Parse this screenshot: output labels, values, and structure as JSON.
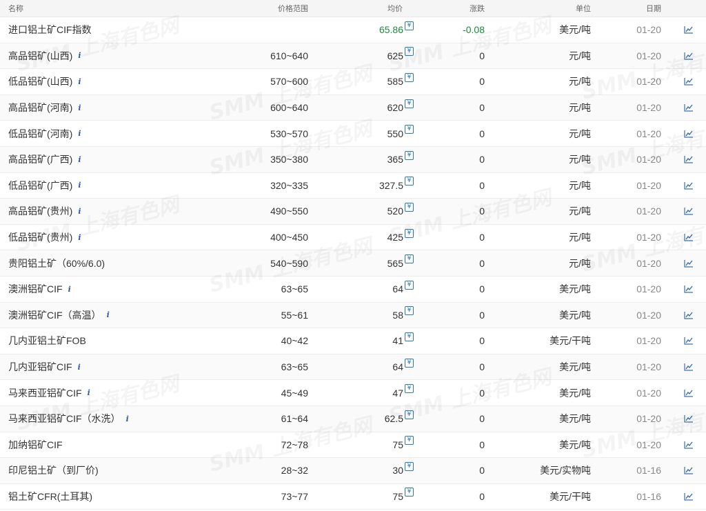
{
  "header": {
    "name": "名称",
    "range": "价格范围",
    "avg": "均价",
    "change": "涨跌",
    "unit": "单位",
    "date": "日期"
  },
  "watermark_text": "SMM 上海有色网",
  "colors": {
    "positive_green": "#1a8a3a",
    "link_blue": "#2a7ab8",
    "header_bg": "#f5f5f5"
  },
  "rows": [
    {
      "name": "进口铝土矿CIF指数",
      "info": false,
      "range": "",
      "avg": "65.86",
      "change": "-0.08",
      "unit": "美元/吨",
      "date": "01-20",
      "highlight": true
    },
    {
      "name": "高品铝矿(山西)",
      "info": true,
      "range": "610~640",
      "avg": "625",
      "change": "0",
      "unit": "元/吨",
      "date": "01-20"
    },
    {
      "name": "低品铝矿(山西)",
      "info": true,
      "range": "570~600",
      "avg": "585",
      "change": "0",
      "unit": "元/吨",
      "date": "01-20"
    },
    {
      "name": "高品铝矿(河南)",
      "info": true,
      "range": "600~640",
      "avg": "620",
      "change": "0",
      "unit": "元/吨",
      "date": "01-20"
    },
    {
      "name": "低品铝矿(河南)",
      "info": true,
      "range": "530~570",
      "avg": "550",
      "change": "0",
      "unit": "元/吨",
      "date": "01-20"
    },
    {
      "name": "高品铝矿(广西)",
      "info": true,
      "range": "350~380",
      "avg": "365",
      "change": "0",
      "unit": "元/吨",
      "date": "01-20"
    },
    {
      "name": "低品铝矿(广西)",
      "info": true,
      "range": "320~335",
      "avg": "327.5",
      "change": "0",
      "unit": "元/吨",
      "date": "01-20"
    },
    {
      "name": "高品铝矿(贵州)",
      "info": true,
      "range": "490~550",
      "avg": "520",
      "change": "0",
      "unit": "元/吨",
      "date": "01-20"
    },
    {
      "name": "低品铝矿(贵州)",
      "info": true,
      "range": "400~450",
      "avg": "425",
      "change": "0",
      "unit": "元/吨",
      "date": "01-20"
    },
    {
      "name": "贵阳铝土矿（60%/6.0)",
      "info": false,
      "range": "540~590",
      "avg": "565",
      "change": "0",
      "unit": "元/吨",
      "date": "01-20"
    },
    {
      "name": "澳洲铝矿CIF",
      "info": true,
      "range": "63~65",
      "avg": "64",
      "change": "0",
      "unit": "美元/吨",
      "date": "01-20"
    },
    {
      "name": "澳洲铝矿CIF（高温）",
      "info": true,
      "range": "55~61",
      "avg": "58",
      "change": "0",
      "unit": "美元/吨",
      "date": "01-20"
    },
    {
      "name": "几内亚铝土矿FOB",
      "info": false,
      "range": "40~42",
      "avg": "41",
      "change": "0",
      "unit": "美元/干吨",
      "date": "01-20"
    },
    {
      "name": "几内亚铝矿CIF",
      "info": true,
      "range": "63~65",
      "avg": "64",
      "change": "0",
      "unit": "美元/吨",
      "date": "01-20"
    },
    {
      "name": "马来西亚铝矿CIF",
      "info": true,
      "range": "45~49",
      "avg": "47",
      "change": "0",
      "unit": "美元/吨",
      "date": "01-20"
    },
    {
      "name": "马来西亚铝矿CIF（水洗）",
      "info": true,
      "range": "61~64",
      "avg": "62.5",
      "change": "0",
      "unit": "美元/吨",
      "date": "01-20"
    },
    {
      "name": "加纳铝矿CIF",
      "info": false,
      "range": "72~78",
      "avg": "75",
      "change": "0",
      "unit": "美元/吨",
      "date": "01-20"
    },
    {
      "name": "印尼铝土矿（到厂价)",
      "info": false,
      "range": "28~32",
      "avg": "30",
      "change": "0",
      "unit": "美元/实物吨",
      "date": "01-16"
    },
    {
      "name": "铝土矿CFR(土耳其)",
      "info": false,
      "range": "73~77",
      "avg": "75",
      "change": "0",
      "unit": "美元/干吨",
      "date": "01-16"
    }
  ]
}
